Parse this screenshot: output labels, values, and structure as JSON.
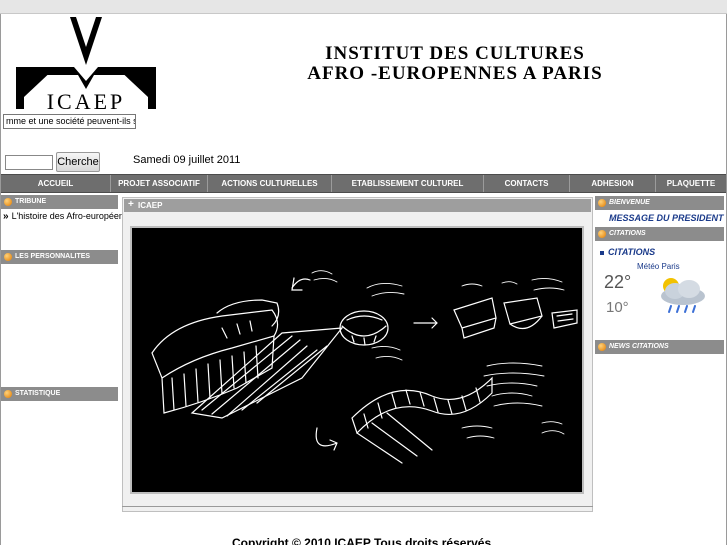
{
  "header": {
    "logo_text": "ICAEP",
    "title_line1": "INSTITUT DES CULTURES",
    "title_line2": "AFRO -EUROPENNES A PARIS",
    "marquee": "mme et une société peuvent-ils se co"
  },
  "search": {
    "button_label": "Cherche",
    "value": ""
  },
  "date": "Samedi 09 juillet 2011",
  "nav": {
    "items": [
      {
        "label": "ACCUEIL"
      },
      {
        "label": "PROJET ASSOCIATIF"
      },
      {
        "label": "ACTIONS CULTURELLES"
      },
      {
        "label": "ETABLISSEMENT CULTUREL"
      },
      {
        "label": "CONTACTS"
      },
      {
        "label": "ADHESION"
      },
      {
        "label": "PLAQUETTE"
      }
    ]
  },
  "left_sidebar": {
    "tribune_title": "TRIBUNE",
    "tribune_link": "L'histoire des Afro-européens",
    "personnalites_title": "LES PERSONNALITES",
    "statistique_title": "STATISTIQUE"
  },
  "center": {
    "panel_title": "ICAEP"
  },
  "right_sidebar": {
    "bienvenue_title": "BIENVENUE",
    "message_link": "MESSAGE DU PRESIDENT",
    "citations_title": "CITATIONS",
    "citations_link": "CITATIONS",
    "news_title": "NEWS CITATIONS"
  },
  "weather": {
    "label": "Météo Paris",
    "high": "22°",
    "low": "10°",
    "icon": "rain-cloud-icon"
  },
  "footer": {
    "copyright": "Copyright © 2010 ICAEP Tous droits réservés"
  },
  "colors": {
    "nav_bg": "#6e6e6e",
    "sidebar_head_bg": "#8c8c8c",
    "link_blue": "#1a3a8a",
    "bullet_orange": "#e07a00"
  }
}
